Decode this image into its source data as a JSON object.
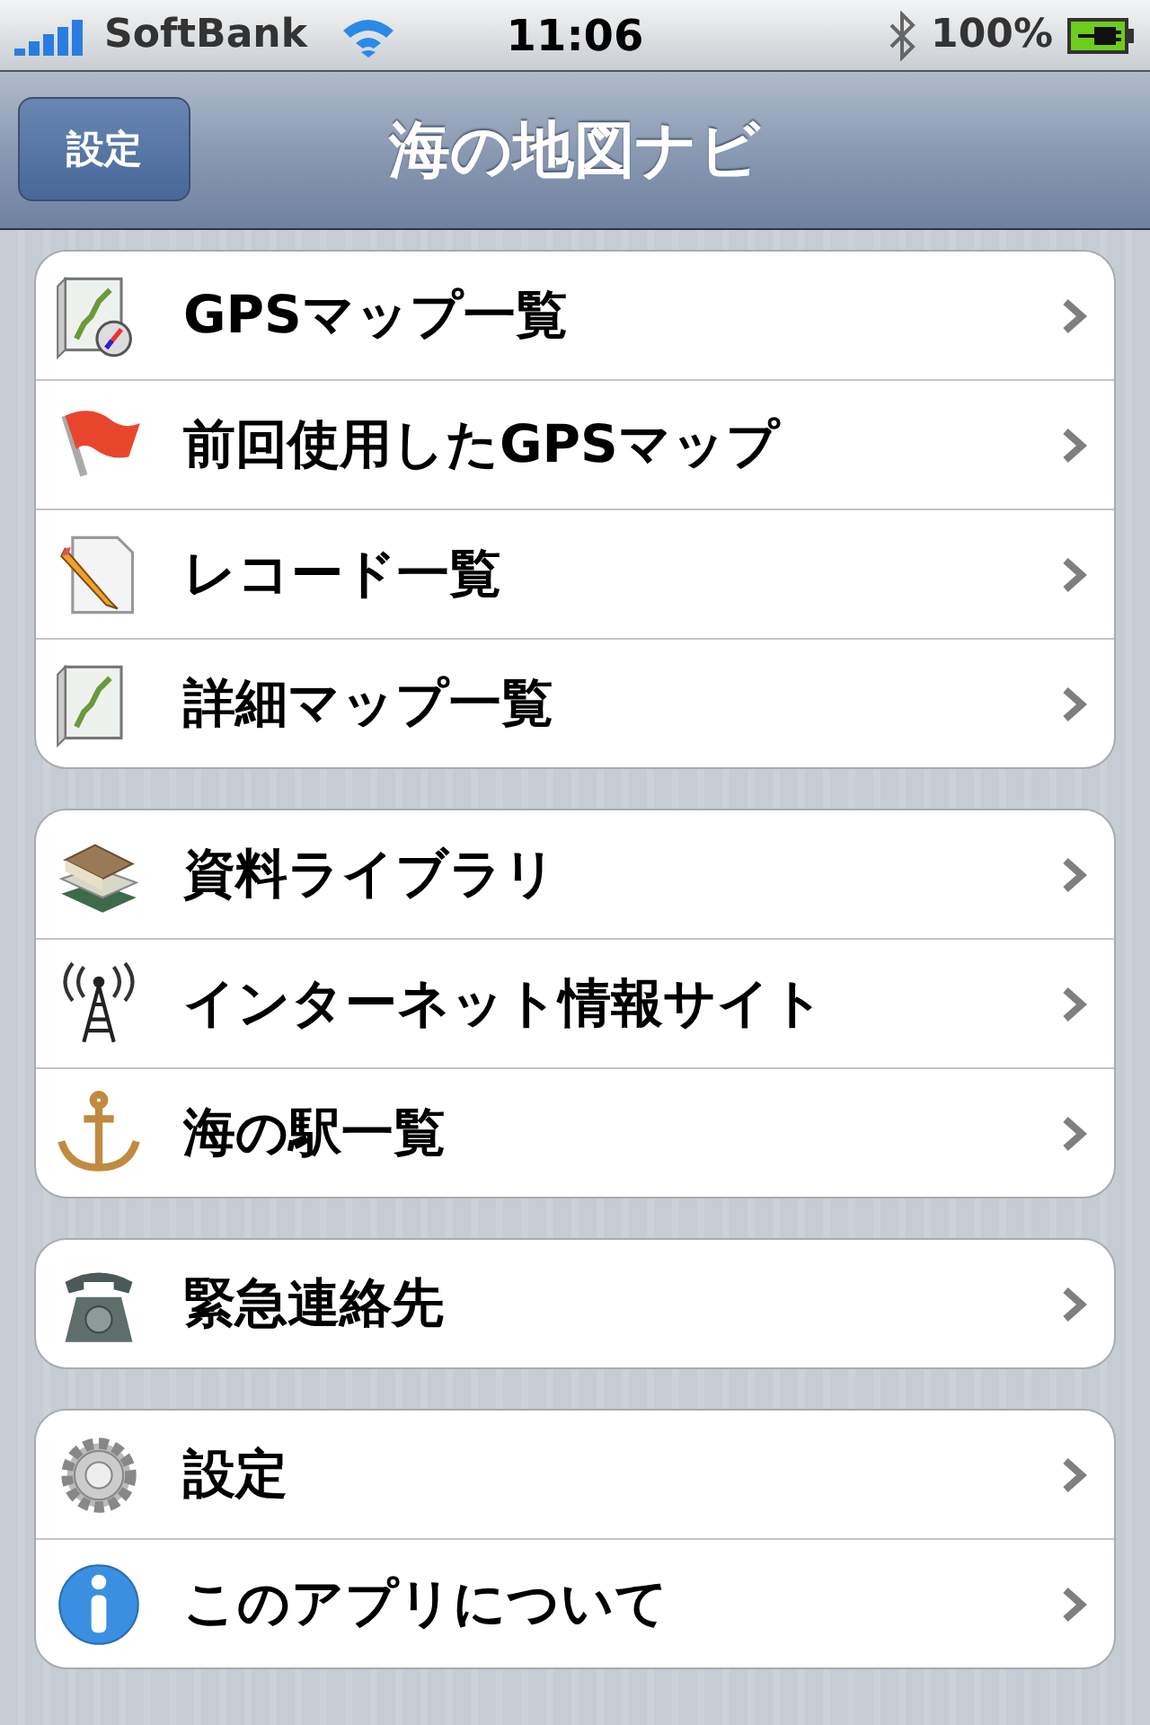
{
  "status_bar": {
    "carrier": "SoftBank",
    "time": "11:06",
    "battery": "100%"
  },
  "nav_bar": {
    "back_button": "設定",
    "title": "海の地図ナビ"
  },
  "groups": [
    {
      "items": [
        {
          "label": "GPSマップ一覧",
          "kind": "mapcompass"
        },
        {
          "label": "前回使用したGPSマップ",
          "kind": "flag"
        },
        {
          "label": "レコード一覧",
          "kind": "pencil"
        },
        {
          "label": "詳細マップ一覧",
          "kind": "map"
        }
      ]
    },
    {
      "items": [
        {
          "label": "資料ライブラリ",
          "kind": "books"
        },
        {
          "label": "インターネット情報サイト",
          "kind": "antenna"
        },
        {
          "label": "海の駅一覧",
          "kind": "anchor"
        }
      ]
    },
    {
      "items": [
        {
          "label": "緊急連絡先",
          "kind": "phone"
        }
      ]
    },
    {
      "items": [
        {
          "label": "設定",
          "kind": "gear"
        },
        {
          "label": "このアプリについて",
          "kind": "info"
        }
      ]
    }
  ]
}
